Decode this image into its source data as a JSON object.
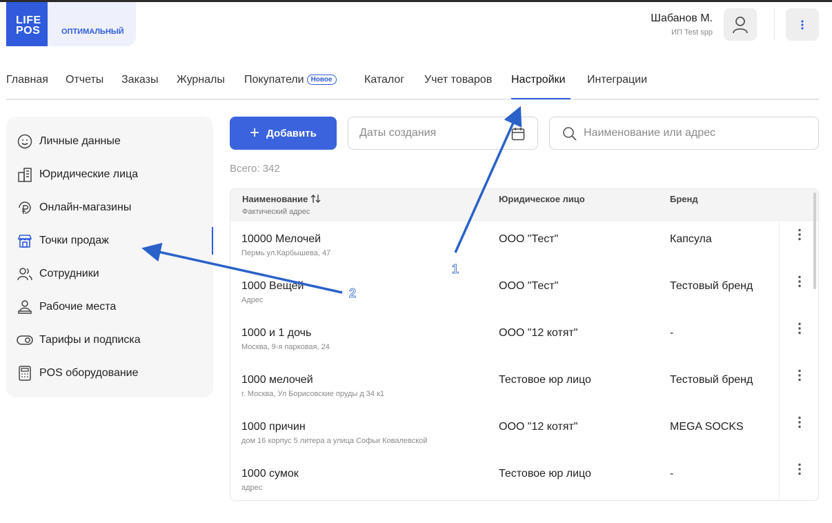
{
  "logo": {
    "line1": "LIFE",
    "line2": "POS",
    "plan": "оптимальный",
    "brand_color": "#2f5bdc"
  },
  "user": {
    "name": "Шабанов М.",
    "org": "ИП Test spp"
  },
  "nav": {
    "items": [
      {
        "label": "Главная"
      },
      {
        "label": "Отчеты"
      },
      {
        "label": "Заказы"
      },
      {
        "label": "Журналы"
      },
      {
        "label": "Покупатели",
        "badge": "Новое"
      },
      {
        "label": "Каталог"
      },
      {
        "label": "Учет товаров"
      },
      {
        "label": "Настройки",
        "active": true
      },
      {
        "label": "Интеграции"
      }
    ]
  },
  "sidebar": {
    "items": [
      {
        "label": "Личные данные",
        "icon": "smile-icon"
      },
      {
        "label": "Юридические лица",
        "icon": "building-icon"
      },
      {
        "label": "Онлайн-магазины",
        "icon": "ruble-cart-icon"
      },
      {
        "label": "Точки продаж",
        "icon": "store-icon",
        "active": true
      },
      {
        "label": "Сотрудники",
        "icon": "users-icon"
      },
      {
        "label": "Рабочие места",
        "icon": "workplace-icon"
      },
      {
        "label": "Тарифы и подписка",
        "icon": "toggle-icon"
      },
      {
        "label": "POS оборудование",
        "icon": "calculator-icon"
      }
    ]
  },
  "toolbar": {
    "add_label": "Добавить",
    "date_placeholder": "Даты создания",
    "search_placeholder": "Наименование или адрес"
  },
  "total": "Всего: 342",
  "table": {
    "headers": {
      "name": "Наименование",
      "address": "Фактический адрес",
      "legal": "Юридическое лицо",
      "brand": "Бренд"
    },
    "rows": [
      {
        "name": "10000 Мелочей",
        "address": "Пермь ул.Карбышева, 47",
        "legal": "ООО \"Тест\"",
        "brand": "Капсула"
      },
      {
        "name": "1000 Вещей",
        "address": "Адрес",
        "legal": "ООО \"Тест\"",
        "brand": "Тестовый бренд"
      },
      {
        "name": "1000 и 1 дочь",
        "address": "Москва, 9-я парковая, 24",
        "legal": "ООО \"12 котят\"",
        "brand": "-"
      },
      {
        "name": "1000 мелочей",
        "address": "г. Москва, Ул Борисовские пруды д 34 к1",
        "legal": "Тестовое юр лицо",
        "brand": "Тестовый бренд"
      },
      {
        "name": "1000 причин",
        "address": "дом 16 корпус 5 литера а улица Софьи Ковалевской",
        "legal": "ООО \"12 котят\"",
        "brand": "MEGA SOCKS"
      },
      {
        "name": "1000 сумок",
        "address": "адрес",
        "legal": "Тестовое юр лицо",
        "brand": "-"
      }
    ]
  },
  "annotations": [
    {
      "label": "1"
    },
    {
      "label": "2"
    }
  ],
  "colors": {
    "accent": "#2f5bdc",
    "arrow": "#2a62c9"
  }
}
